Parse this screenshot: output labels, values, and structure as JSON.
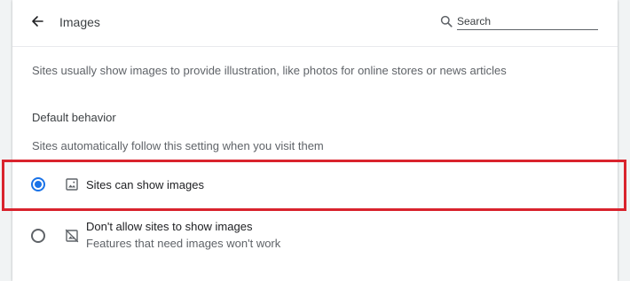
{
  "header": {
    "title": "Images",
    "back_icon": "arrow-left-icon",
    "search": {
      "placeholder": "Search",
      "icon": "search-icon"
    }
  },
  "description": "Sites usually show images to provide illustration, like photos for online stores or news articles",
  "default_behavior": {
    "title": "Default behavior",
    "subtitle": "Sites automatically follow this setting when you visit them",
    "options": [
      {
        "label": "Sites can show images",
        "sublabel": "",
        "icon": "image-icon",
        "selected": true
      },
      {
        "label": "Don't allow sites to show images",
        "sublabel": "Features that need images won't work",
        "icon": "image-off-icon",
        "selected": false
      }
    ]
  },
  "colors": {
    "accent": "#1a73e8",
    "highlight_border": "#d9232d"
  }
}
